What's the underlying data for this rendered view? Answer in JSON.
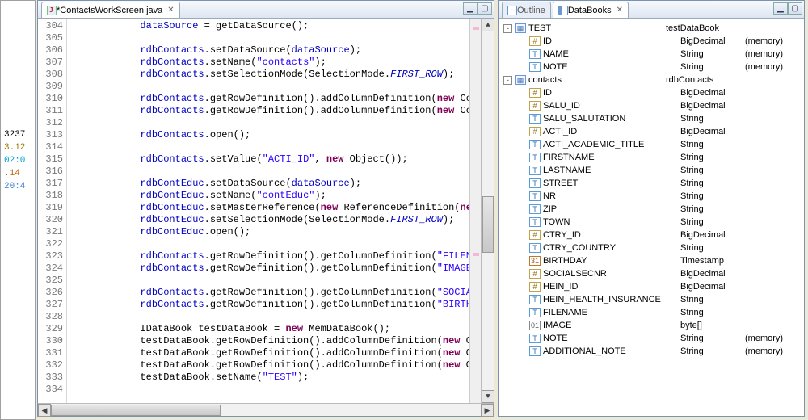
{
  "editor": {
    "tab": {
      "label": "*ContactsWorkScreen.java"
    },
    "lineNumbers": [
      "304",
      "305",
      "306",
      "307",
      "308",
      "309",
      "310",
      "311",
      "312",
      "313",
      "314",
      "315",
      "316",
      "317",
      "318",
      "319",
      "320",
      "321",
      "322",
      "323",
      "324",
      "325",
      "326",
      "327",
      "328",
      "329",
      "330",
      "331",
      "332",
      "333",
      "334"
    ],
    "lines": [
      "{{SP20}}<span class='fld'>dataSource</span> = getDataSource();",
      "",
      "{{SP20}}<span class='fld'>rdbContacts</span>.setDataSource(<span class='fld'>dataSource</span>);",
      "{{SP20}}<span class='fld'>rdbContacts</span>.setName(<span class='st'>\"contacts\"</span>);",
      "{{SP20}}<span class='fld'>rdbContacts</span>.setSelectionMode(SelectionMode.<span class='cn'>FIRST_ROW</span>);",
      "",
      "{{SP20}}<span class='fld'>rdbContacts</span>.getRowDefinition().addColumnDefinition(<span class='kw'>new</span> Colum",
      "{{SP20}}<span class='fld'>rdbContacts</span>.getRowDefinition().addColumnDefinition(<span class='kw'>new</span> Colum",
      "",
      "{{SP20}}<span class='fld'>rdbContacts</span>.open();",
      "",
      "{{SP20}}<span class='fld'>rdbContacts</span>.setValue(<span class='st'>\"ACTI_ID\"</span>, <span class='kw'>new</span> Object());",
      "",
      "{{SP20}}<span class='fld'>rdbContEduc</span>.setDataSource(<span class='fld'>dataSource</span>);",
      "{{SP20}}<span class='fld'>rdbContEduc</span>.setName(<span class='st'>\"contEduc\"</span>);",
      "{{SP20}}<span class='fld'>rdbContEduc</span>.setMasterReference(<span class='kw'>new</span> ReferenceDefinition(<span class='kw'>new</span> S",
      "{{SP20}}<span class='fld'>rdbContEduc</span>.setSelectionMode(SelectionMode.<span class='cn'>FIRST_ROW</span>);",
      "{{SP20}}<span class='fld'>rdbContEduc</span>.open();",
      "",
      "{{SP20}}<span class='fld'>rdbContacts</span>.getRowDefinition().getColumnDefinition(<span class='st'>\"FILENAME</span>",
      "{{SP20}}<span class='fld'>rdbContacts</span>.getRowDefinition().getColumnDefinition(<span class='st'>\"IMAGE\"</span>).",
      "",
      "{{SP20}}<span class='fld'>rdbContacts</span>.getRowDefinition().getColumnDefinition(<span class='st'>\"SOCIALSE</span>",
      "{{SP20}}<span class='fld'>rdbContacts</span>.getRowDefinition().getColumnDefinition(<span class='st'>\"BIRTHDAY</span>",
      "",
      "{{SP20}}IDataBook testDataBook = <span class='kw'>new</span> MemDataBook();",
      "{{SP20}}testDataBook.getRowDefinition().addColumnDefinition(<span class='kw'>new</span> Colu",
      "{{SP20}}testDataBook.getRowDefinition().addColumnDefinition(<span class='kw'>new</span> Colu",
      "{{SP20}}testDataBook.getRowDefinition().addColumnDefinition(<span class='kw'>new</span> Colu",
      "{{SP20}}testDataBook.setName(<span class='st'>\"TEST\"</span>);",
      ""
    ]
  },
  "rightTabs": {
    "outline": "Outline",
    "databooks": "DataBooks"
  },
  "memoryLabel": "(memory)",
  "tree": [
    {
      "d": 0,
      "exp": "-",
      "icon": "db",
      "name": "TEST",
      "type": "testDataBook",
      "mem": ""
    },
    {
      "d": 1,
      "exp": "",
      "icon": "num",
      "name": "ID",
      "type": "BigDecimal",
      "mem": "(memory)"
    },
    {
      "d": 1,
      "exp": "",
      "icon": "txt",
      "name": "NAME",
      "type": "String",
      "mem": "(memory)"
    },
    {
      "d": 1,
      "exp": "",
      "icon": "txt",
      "name": "NOTE",
      "type": "String",
      "mem": "(memory)"
    },
    {
      "d": 0,
      "exp": "-",
      "icon": "db",
      "name": "contacts",
      "type": "rdbContacts",
      "mem": ""
    },
    {
      "d": 1,
      "exp": "",
      "icon": "num",
      "name": "ID",
      "type": "BigDecimal",
      "mem": ""
    },
    {
      "d": 1,
      "exp": "",
      "icon": "num",
      "name": "SALU_ID",
      "type": "BigDecimal",
      "mem": ""
    },
    {
      "d": 1,
      "exp": "",
      "icon": "txt",
      "name": "SALU_SALUTATION",
      "type": "String",
      "mem": ""
    },
    {
      "d": 1,
      "exp": "",
      "icon": "num",
      "name": "ACTI_ID",
      "type": "BigDecimal",
      "mem": ""
    },
    {
      "d": 1,
      "exp": "",
      "icon": "txt",
      "name": "ACTI_ACADEMIC_TITLE",
      "type": "String",
      "mem": ""
    },
    {
      "d": 1,
      "exp": "",
      "icon": "txt",
      "name": "FIRSTNAME",
      "type": "String",
      "mem": ""
    },
    {
      "d": 1,
      "exp": "",
      "icon": "txt",
      "name": "LASTNAME",
      "type": "String",
      "mem": ""
    },
    {
      "d": 1,
      "exp": "",
      "icon": "txt",
      "name": "STREET",
      "type": "String",
      "mem": ""
    },
    {
      "d": 1,
      "exp": "",
      "icon": "txt",
      "name": "NR",
      "type": "String",
      "mem": ""
    },
    {
      "d": 1,
      "exp": "",
      "icon": "txt",
      "name": "ZIP",
      "type": "String",
      "mem": ""
    },
    {
      "d": 1,
      "exp": "",
      "icon": "txt",
      "name": "TOWN",
      "type": "String",
      "mem": ""
    },
    {
      "d": 1,
      "exp": "",
      "icon": "num",
      "name": "CTRY_ID",
      "type": "BigDecimal",
      "mem": ""
    },
    {
      "d": 1,
      "exp": "",
      "icon": "txt",
      "name": "CTRY_COUNTRY",
      "type": "String",
      "mem": ""
    },
    {
      "d": 1,
      "exp": "",
      "icon": "dt",
      "name": "BIRTHDAY",
      "type": "Timestamp",
      "mem": ""
    },
    {
      "d": 1,
      "exp": "",
      "icon": "num",
      "name": "SOCIALSECNR",
      "type": "BigDecimal",
      "mem": ""
    },
    {
      "d": 1,
      "exp": "",
      "icon": "num",
      "name": "HEIN_ID",
      "type": "BigDecimal",
      "mem": ""
    },
    {
      "d": 1,
      "exp": "",
      "icon": "txt",
      "name": "HEIN_HEALTH_INSURANCE",
      "type": "String",
      "mem": ""
    },
    {
      "d": 1,
      "exp": "",
      "icon": "txt",
      "name": "FILENAME",
      "type": "String",
      "mem": ""
    },
    {
      "d": 1,
      "exp": "",
      "icon": "bin",
      "name": "IMAGE",
      "type": "byte[]",
      "mem": ""
    },
    {
      "d": 1,
      "exp": "",
      "icon": "txt",
      "name": "NOTE",
      "type": "String",
      "mem": "(memory)"
    },
    {
      "d": 1,
      "exp": "",
      "icon": "txt",
      "name": "ADDITIONAL_NOTE",
      "type": "String",
      "mem": "(memory)"
    }
  ],
  "gutter": {
    "l1": "3237",
    "l2": "3.12",
    "l3": "02:0",
    "l4": ".14",
    "l5": "20:4"
  }
}
